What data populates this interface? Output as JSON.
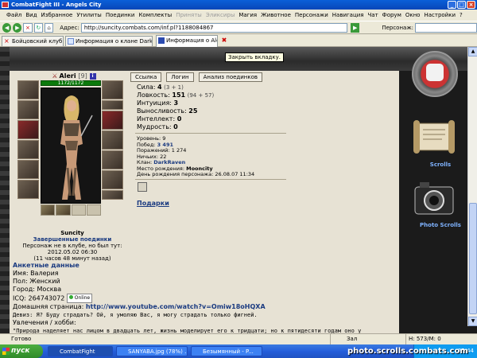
{
  "window": {
    "title": "CombatFight III - Angels City"
  },
  "menu": [
    "Файл",
    "Вид",
    "Избранное",
    "Утилиты",
    "Поединки",
    "Комплекты",
    "Приняты",
    "Эликсиры",
    "Магия",
    "Животное",
    "Персонажи",
    "Навигация",
    "Чат",
    "Форум",
    "Окно",
    "Настройки",
    "?"
  ],
  "menu_disabled": [
    "Приняты",
    "Эликсиры"
  ],
  "address": {
    "label": "Адрес:",
    "value": "http://suncity.combats.com/inf.pl?1188084867",
    "persona_label": "Персонаж:"
  },
  "tabs": [
    {
      "label": "Бойцовский клуб"
    },
    {
      "label": "Информация о клане DarkRaven"
    },
    {
      "label": "Информация о Aleri"
    }
  ],
  "tooltip": "Закрыть вкладку.",
  "character": {
    "name": "Aleri",
    "level": "[9]",
    "hp": "1172/1172",
    "guild_name": "Suncity",
    "guild_status": "Завершенные поединки",
    "offline_text": "Персонаж не в клубе, но был тут:",
    "offline_date": "2012.05.02 06:30",
    "offline_ago": "(11 часов 48 минут назад)"
  },
  "profile_buttons": [
    "Ссылка",
    "Логин",
    "Анализ поединков"
  ],
  "stats": [
    {
      "label": "Сила:",
      "value": "4",
      "extra": "(3 + 1)"
    },
    {
      "label": "Ловкость:",
      "value": "151",
      "extra": "(94 + 57)"
    },
    {
      "label": "Интуиция:",
      "value": "3",
      "extra": ""
    },
    {
      "label": "Выносливость:",
      "value": "25",
      "extra": ""
    },
    {
      "label": "Интеллект:",
      "value": "0",
      "extra": ""
    },
    {
      "label": "Мудрость:",
      "value": "0",
      "extra": ""
    }
  ],
  "details": [
    {
      "label": "Уровень:",
      "value": "9",
      "style": ""
    },
    {
      "label": "Побед:",
      "value": "3 491",
      "style": "blue"
    },
    {
      "label": "Поражений:",
      "value": "1 274",
      "style": ""
    },
    {
      "label": "Ничьих:",
      "value": "22",
      "style": ""
    },
    {
      "label": "Клан:",
      "value": "DarkRaven",
      "style": "blue"
    },
    {
      "label": "Место рождения:",
      "value": "Mooncity",
      "style": "b"
    },
    {
      "label": "День рождения персонажа:",
      "value": "26.08.07 11:34",
      "style": ""
    }
  ],
  "gifts_label": "Подарки",
  "about": {
    "header": "Анкетные данные",
    "name": "Имя: Валерия",
    "gender": "Пол: Женский",
    "city": "Город: Москва",
    "icq_label": "ICQ: 264743072",
    "icq_status": "Online",
    "homepage_label": "Домашняя страница:",
    "homepage_url": "http://www.youtube.com/watch?v=Omiw18oHQXA",
    "motto": "Девиз: Я? Буду страдать? Ой, я умоляю Вас, я могу страдать только фигней.",
    "hobby_label": "Увлечения / хобби:",
    "hobby_text": "\"Природа наделяет нас лицом в двадцать лет, жизнь моделирует его к тридцати; но к пятидесяти годам оно у"
  },
  "sidebar_right": {
    "scrolls_label": "Scrolls",
    "photo_label": "Photo Scrolls"
  },
  "status": {
    "text": "Готово",
    "zone": "Зал воинов",
    "memory": "Н: 573/М: 0"
  },
  "taskbar": {
    "start": "пуск",
    "tasks": [
      {
        "label": "CombatFight"
      },
      {
        "label": "SANYABA.jpg (78%) ..."
      },
      {
        "label": "Безымянный - P..."
      }
    ],
    "clock": "15:44"
  },
  "watermark": "photo.scrolls.combats.com",
  "colors": {
    "title_bar": "#0846b8",
    "page_bg": "#e7e2d4",
    "link_blue": "#1a3a80",
    "hp_green": "#0b7a0b"
  }
}
